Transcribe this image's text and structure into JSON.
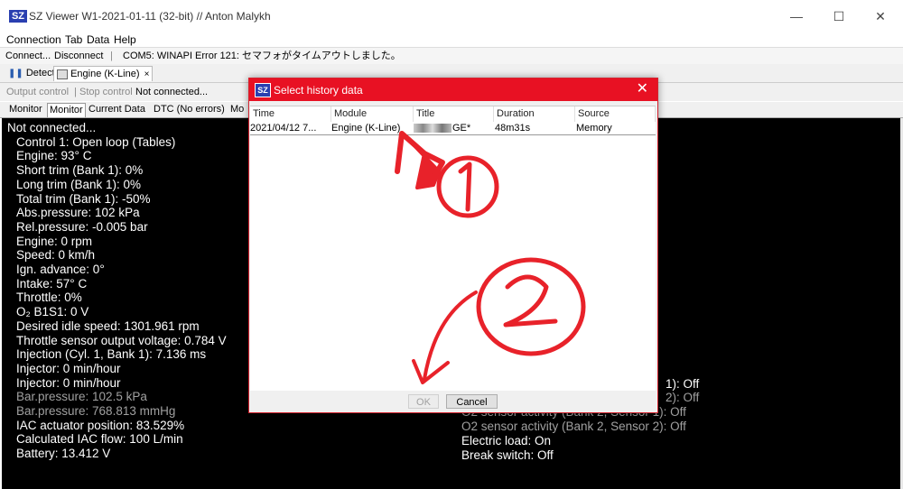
{
  "window": {
    "app_icon_text": "SZ",
    "title": "SZ Viewer W1-2021-01-11 (32-bit) // Anton Malykh",
    "minimize_glyph": "—",
    "maximize_glyph": "☐",
    "close_glyph": "✕"
  },
  "menu": [
    "Connection",
    "Tab",
    "Data",
    "Help"
  ],
  "toolbar": {
    "connect": "Connect...",
    "disconnect": "Disconnect",
    "status": "COM5: WINAPI Error 121: セマフォがタイムアウトしました。"
  },
  "tabs": {
    "detect": "Detect",
    "engine": "Engine (K-Line)",
    "engine_close": "×"
  },
  "controls": {
    "output_control": "Output control",
    "stop_control": "Stop control",
    "status": "Not connected..."
  },
  "subtabs": [
    "Monitor",
    "Monitor",
    "Current Data",
    "DTC (No errors)",
    "Mo"
  ],
  "monitor": {
    "left": [
      {
        "text": "Not connected...",
        "gray": false
      },
      {
        "text": "Control 1: Open loop (Tables)",
        "gray": false
      },
      {
        "text": "Engine: 93° C",
        "gray": false
      },
      {
        "text": "Short trim (Bank 1): 0%",
        "gray": false
      },
      {
        "text": "Long trim (Bank 1): 0%",
        "gray": false
      },
      {
        "text": "Total trim (Bank 1): -50%",
        "gray": false
      },
      {
        "text": "Abs.pressure: 102 kPa",
        "gray": false
      },
      {
        "text": "Rel.pressure: -0.005 bar",
        "gray": false
      },
      {
        "text": "Engine: 0 rpm",
        "gray": false
      },
      {
        "text": "Speed: 0 km/h",
        "gray": false
      },
      {
        "text": "Ign. advance: 0°",
        "gray": false
      },
      {
        "text": "Intake: 57° C",
        "gray": false
      },
      {
        "text": "Throttle: 0%",
        "gray": false
      },
      {
        "text": "O₂ B1S1: 0 V",
        "gray": false
      },
      {
        "text": "Desired idle speed: 1301.961 rpm",
        "gray": false
      },
      {
        "text": "Throttle sensor output voltage: 0.784 V",
        "gray": false
      },
      {
        "text": "Injection (Cyl. 1, Bank 1): 7.136 ms",
        "gray": false
      },
      {
        "text": "Injector: 0 min/hour",
        "gray": false
      },
      {
        "text": "Injector: 0 min/hour",
        "gray": false
      },
      {
        "text": "Bar.pressure: 102.5 kPa",
        "gray": true
      },
      {
        "text": "Bar.pressure: 768.813 mmHg",
        "gray": true
      },
      {
        "text": "IAC actuator position: 83.529%",
        "gray": false
      },
      {
        "text": "Calculated IAC flow: 100 L/min",
        "gray": false
      },
      {
        "text": "Battery: 13.412 V",
        "gray": false
      }
    ],
    "right": [
      {
        "text": "1): Off",
        "gray": false
      },
      {
        "text": "2): Off",
        "gray": true
      },
      {
        "text": "O2 sensor activity (Bank 2, Sensor 1): Off",
        "gray": true
      },
      {
        "text": "O2 sensor activity (Bank 2, Sensor 2): Off",
        "gray": true
      },
      {
        "text": "Electric load: On",
        "gray": false
      },
      {
        "text": "Break switch: Off",
        "gray": false
      }
    ]
  },
  "dialog": {
    "icon_text": "SZ",
    "title": "Select history data",
    "close_glyph": "✕",
    "columns": [
      "Time",
      "Module",
      "Title",
      "Duration",
      "Source"
    ],
    "rows": [
      {
        "time": "2021/04/12 7...",
        "module": "Engine (K-Line)",
        "title": "GE*",
        "duration": "48m31s",
        "source": "Memory"
      }
    ],
    "ok_label": "OK",
    "cancel_label": "Cancel"
  },
  "annotations": {
    "color": "#e8222a",
    "marks": [
      "①",
      "②"
    ]
  }
}
